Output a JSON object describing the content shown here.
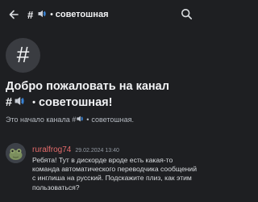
{
  "header": {
    "channel_hash": "#",
    "channel_name": "советошная",
    "separator": "•"
  },
  "channel_icon": {
    "glyph": "#"
  },
  "welcome": {
    "line1": "Добро пожаловать на канал",
    "hash": "#",
    "separator": "•",
    "channel_name": "советошная!"
  },
  "start": {
    "prefix": "Это начало канала #",
    "separator": "•",
    "channel_name": "советошная."
  },
  "message": {
    "author": "ruralfrog74",
    "timestamp": "29.02.2024 13:40",
    "text": "Ребята! Тут в дискорде вроде есть какая-то команда автоматического переводчика сообщений с инглиша на русский. Подскажите плиз, как этим пользоваться?"
  },
  "colors": {
    "background": "#1e1f22",
    "author": "#e46b6b",
    "muted_text": "#b5bac1",
    "sound_emoji": "#3b8eea"
  },
  "icons": {
    "back": "arrow-left-icon",
    "search": "search-icon",
    "sound": "speaker-emoji-icon"
  }
}
